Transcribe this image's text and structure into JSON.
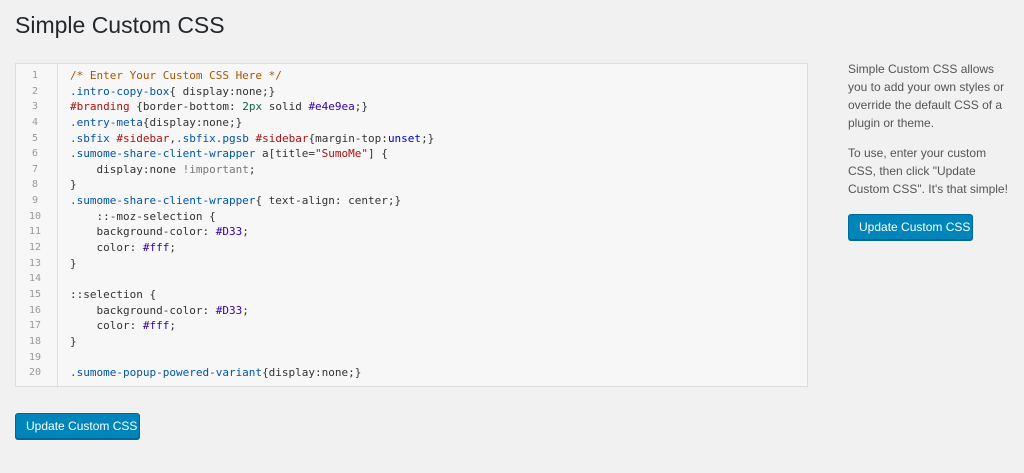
{
  "page": {
    "title": "Simple Custom CSS"
  },
  "editor": {
    "lines": [
      {
        "n": "1",
        "tokens": [
          {
            "t": "/* Enter Your Custom CSS Here */",
            "c": "comment"
          }
        ]
      },
      {
        "n": "2",
        "tokens": [
          {
            "t": ".intro-copy-box",
            "c": "sel"
          },
          {
            "t": "{ display:none;}",
            "c": "plain"
          }
        ]
      },
      {
        "n": "3",
        "tokens": [
          {
            "t": "#branding",
            "c": "id"
          },
          {
            "t": " {border-bottom: ",
            "c": "plain"
          },
          {
            "t": "2px",
            "c": "num"
          },
          {
            "t": " solid ",
            "c": "plain"
          },
          {
            "t": "#e4e9ea",
            "c": "val"
          },
          {
            "t": ";}",
            "c": "plain"
          }
        ]
      },
      {
        "n": "4",
        "tokens": [
          {
            "t": ".entry-meta",
            "c": "sel"
          },
          {
            "t": "{display:none;}",
            "c": "plain"
          }
        ]
      },
      {
        "n": "5",
        "tokens": [
          {
            "t": ".sbfix",
            "c": "sel"
          },
          {
            "t": " ",
            "c": "plain"
          },
          {
            "t": "#sidebar",
            "c": "id"
          },
          {
            "t": ",",
            "c": "plain"
          },
          {
            "t": ".sbfix.pgsb",
            "c": "sel"
          },
          {
            "t": " ",
            "c": "plain"
          },
          {
            "t": "#sidebar",
            "c": "id"
          },
          {
            "t": "{margin-top:",
            "c": "plain"
          },
          {
            "t": "unset",
            "c": "kw"
          },
          {
            "t": ";}",
            "c": "plain"
          }
        ]
      },
      {
        "n": "6",
        "tokens": [
          {
            "t": ".sumome-share-client-wrapper",
            "c": "sel"
          },
          {
            "t": " a[title=",
            "c": "plain"
          },
          {
            "t": "\"SumoMe\"",
            "c": "str"
          },
          {
            "t": "] {",
            "c": "plain"
          }
        ]
      },
      {
        "n": "7",
        "tokens": [
          {
            "t": "    display:none ",
            "c": "plain"
          },
          {
            "t": "!important",
            "c": "imp"
          },
          {
            "t": ";",
            "c": "plain"
          }
        ]
      },
      {
        "n": "8",
        "tokens": [
          {
            "t": "}",
            "c": "plain"
          }
        ]
      },
      {
        "n": "9",
        "tokens": [
          {
            "t": ".sumome-share-client-wrapper",
            "c": "sel"
          },
          {
            "t": "{ text-align: center;}",
            "c": "plain"
          }
        ]
      },
      {
        "n": "10",
        "tokens": [
          {
            "t": "    ::-moz-selection {",
            "c": "plain"
          }
        ]
      },
      {
        "n": "11",
        "tokens": [
          {
            "t": "    background-color: ",
            "c": "plain"
          },
          {
            "t": "#D33",
            "c": "val"
          },
          {
            "t": ";",
            "c": "plain"
          }
        ]
      },
      {
        "n": "12",
        "tokens": [
          {
            "t": "    color: ",
            "c": "plain"
          },
          {
            "t": "#fff",
            "c": "val"
          },
          {
            "t": ";",
            "c": "plain"
          }
        ]
      },
      {
        "n": "13",
        "tokens": [
          {
            "t": "}",
            "c": "plain"
          }
        ]
      },
      {
        "n": "14",
        "tokens": []
      },
      {
        "n": "15",
        "tokens": [
          {
            "t": "::selection {",
            "c": "plain"
          }
        ]
      },
      {
        "n": "16",
        "tokens": [
          {
            "t": "    background-color: ",
            "c": "plain"
          },
          {
            "t": "#D33",
            "c": "val"
          },
          {
            "t": ";",
            "c": "plain"
          }
        ]
      },
      {
        "n": "17",
        "tokens": [
          {
            "t": "    color: ",
            "c": "plain"
          },
          {
            "t": "#fff",
            "c": "val"
          },
          {
            "t": ";",
            "c": "plain"
          }
        ]
      },
      {
        "n": "18",
        "tokens": [
          {
            "t": "}",
            "c": "plain"
          }
        ]
      },
      {
        "n": "19",
        "tokens": []
      },
      {
        "n": "20",
        "tokens": [
          {
            "t": ".sumome-popup-powered-variant",
            "c": "sel"
          },
          {
            "t": "{display:none;}",
            "c": "plain"
          }
        ]
      }
    ]
  },
  "sidebar": {
    "description_1": "Simple Custom CSS allows you to add your own styles or override the default CSS of a plugin or theme.",
    "description_2": "To use, enter your custom CSS, then click \"Update Custom CSS\". It's that simple!",
    "button_label": "Update Custom CSS"
  },
  "footer": {
    "button_label": "Update Custom CSS"
  },
  "colors": {
    "accent": "#0085ba",
    "background": "#f1f1f1",
    "editor_background": "#f7f7f7"
  }
}
